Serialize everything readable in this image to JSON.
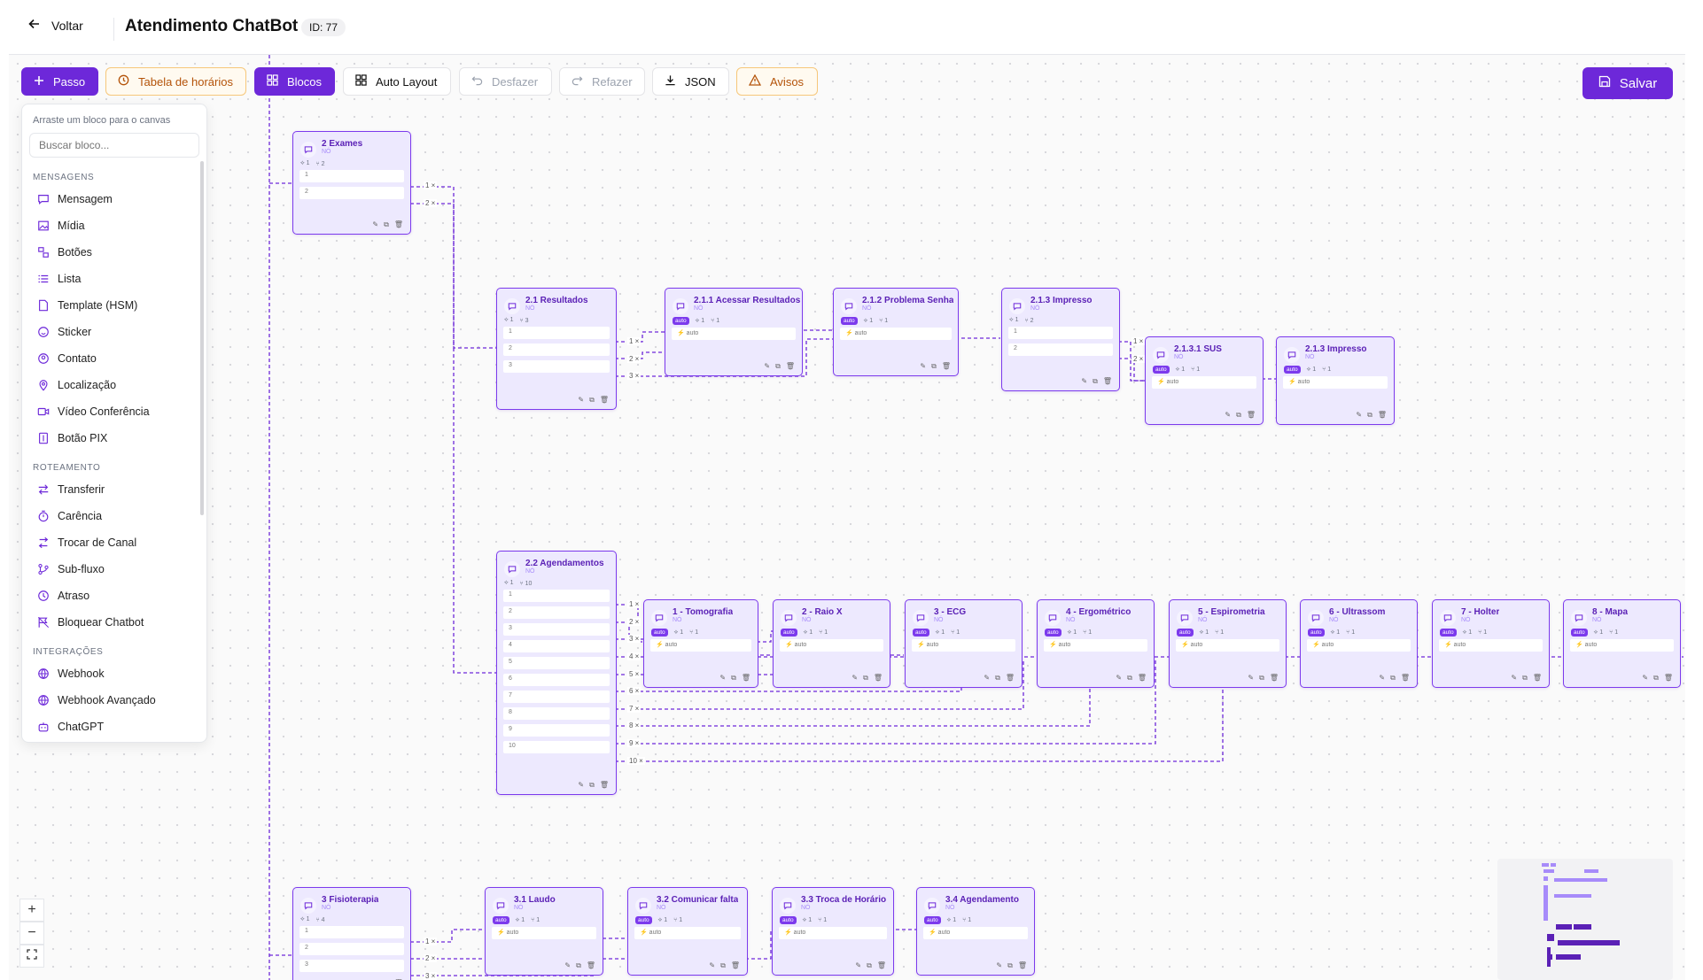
{
  "header": {
    "back_label": "Voltar",
    "title": "Atendimento ChatBot",
    "id_badge": "ID: 77"
  },
  "toolbar": {
    "passo": "Passo",
    "tabela": "Tabela de horários",
    "blocos": "Blocos",
    "auto_layout": "Auto Layout",
    "desfazer": "Desfazer",
    "refazer": "Refazer",
    "json": "JSON",
    "avisos": "Avisos",
    "salvar": "Salvar"
  },
  "colors": {
    "accent": "#6d28d9",
    "node_bg": "#ede9fe",
    "node_border": "#7c3aed",
    "warning": "#b45309"
  },
  "panel": {
    "hint": "Arraste um bloco para o canvas",
    "search_placeholder": "Buscar bloco...",
    "sections": [
      {
        "title": "MENSAGENS",
        "items": [
          {
            "label": "Mensagem",
            "icon": "message-icon"
          },
          {
            "label": "Mídia",
            "icon": "image-icon"
          },
          {
            "label": "Botões",
            "icon": "buttons-icon"
          },
          {
            "label": "Lista",
            "icon": "list-icon"
          },
          {
            "label": "Template (HSM)",
            "icon": "template-icon"
          },
          {
            "label": "Sticker",
            "icon": "sticker-icon"
          },
          {
            "label": "Contato",
            "icon": "contact-icon"
          },
          {
            "label": "Localização",
            "icon": "location-icon"
          },
          {
            "label": "Vídeo Conferência",
            "icon": "video-icon"
          },
          {
            "label": "Botão PIX",
            "icon": "pix-icon"
          }
        ]
      },
      {
        "title": "ROTEAMENTO",
        "items": [
          {
            "label": "Transferir",
            "icon": "transfer-icon"
          },
          {
            "label": "Carência",
            "icon": "timer-icon"
          },
          {
            "label": "Trocar de Canal",
            "icon": "switch-channel-icon"
          },
          {
            "label": "Sub-fluxo",
            "icon": "subflow-icon"
          },
          {
            "label": "Atraso",
            "icon": "clock-icon"
          },
          {
            "label": "Bloquear Chatbot",
            "icon": "block-icon"
          }
        ]
      },
      {
        "title": "INTEGRAÇÕES",
        "items": [
          {
            "label": "Webhook",
            "icon": "globe-icon"
          },
          {
            "label": "Webhook Avançado",
            "icon": "globe-icon"
          },
          {
            "label": "ChatGPT",
            "icon": "bot-icon"
          }
        ]
      }
    ]
  },
  "node_common": {
    "subtitle": "NÓ",
    "auto_badge": "auto",
    "auto_row": "auto"
  },
  "nodes": [
    {
      "title": "2 Exames",
      "meta": [
        "1",
        "2"
      ],
      "rows": [
        "1",
        "2"
      ]
    },
    {
      "title": "2.1 Resultados",
      "meta": [
        "1",
        "3"
      ],
      "rows": [
        "1",
        "2",
        "3"
      ]
    },
    {
      "title": "2.1.1 Acessar Resultados",
      "meta": [
        "1",
        "1"
      ],
      "auto": true
    },
    {
      "title": "2.1.2 Problema Senha",
      "meta": [
        "1",
        "1"
      ],
      "auto": true
    },
    {
      "title": "2.1.3 Impresso",
      "meta": [
        "1",
        "2"
      ],
      "rows": [
        "1",
        "2"
      ]
    },
    {
      "title": "2.1.3.1 SUS",
      "meta": [
        "1",
        "1"
      ],
      "auto": true
    },
    {
      "title": "2.1.3 Impresso",
      "meta": [
        "1",
        "1"
      ],
      "auto": true
    },
    {
      "title": "2.2 Agendamentos",
      "meta": [
        "1",
        "10"
      ],
      "rows": [
        "1",
        "2",
        "3",
        "4",
        "5",
        "6",
        "7",
        "8",
        "9",
        "10"
      ]
    },
    {
      "title": "1 - Tomografia",
      "meta": [
        "1",
        "1"
      ],
      "auto": true
    },
    {
      "title": "2 - Raio X",
      "meta": [
        "1",
        "1"
      ],
      "auto": true
    },
    {
      "title": "3 - ECG",
      "meta": [
        "1",
        "1"
      ],
      "auto": true
    },
    {
      "title": "4 - Ergométrico",
      "meta": [
        "1",
        "1"
      ],
      "auto": true
    },
    {
      "title": "5 - Espirometria",
      "meta": [
        "1",
        "1"
      ],
      "auto": true
    },
    {
      "title": "6 - Ultrassom",
      "meta": [
        "1",
        "1"
      ],
      "auto": true
    },
    {
      "title": "7 - Holter",
      "meta": [
        "1",
        "1"
      ],
      "auto": true
    },
    {
      "title": "8 - Mapa",
      "meta": [
        "1",
        "1"
      ],
      "auto": true
    },
    {
      "title": "3 Fisioterapia",
      "meta": [
        "1",
        "4"
      ],
      "rows": [
        "1",
        "2",
        "3"
      ]
    },
    {
      "title": "3.1 Laudo",
      "meta": [
        "1",
        "1"
      ],
      "auto": true
    },
    {
      "title": "3.2 Comunicar falta",
      "meta": [
        "1",
        "1"
      ],
      "auto": true
    },
    {
      "title": "3.3 Troca de Horário",
      "meta": [
        "1",
        "1"
      ],
      "auto": true
    },
    {
      "title": "3.4 Agendamento",
      "meta": [
        "1",
        "1"
      ],
      "auto": true
    }
  ],
  "edge_labels": [
    "1",
    "2",
    "1",
    "2",
    "3",
    "1",
    "2",
    "1",
    "2",
    "3",
    "4",
    "5",
    "6",
    "7",
    "8",
    "9",
    "10",
    "1",
    "2",
    "3"
  ],
  "zoom_controls": {
    "zoom_in": "+",
    "zoom_out": "−"
  }
}
